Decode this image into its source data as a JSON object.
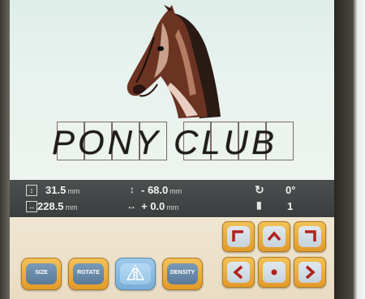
{
  "design": {
    "title_text": "PONY CLUB",
    "image": "horse-head"
  },
  "info": {
    "height": "31.5",
    "width": "228.5",
    "offset_v": "- 68.0",
    "offset_h": "+ 0.0",
    "unit": "mm",
    "rotation": "0°",
    "thread_changes": "1"
  },
  "buttons": {
    "size": "SIZE",
    "rotate": "ROTATE",
    "density": "DENSITY"
  },
  "arrow_icons": [
    "arrow-up-left-icon",
    "arrow-up-icon",
    "arrow-up-right-icon",
    "arrow-left-icon",
    "center-icon",
    "arrow-right-icon"
  ],
  "colors": {
    "button_orange": "#e89f2c",
    "info_bar": "#434747",
    "arrow_red": "#b0221e",
    "canvas": "#e6f1ed"
  }
}
